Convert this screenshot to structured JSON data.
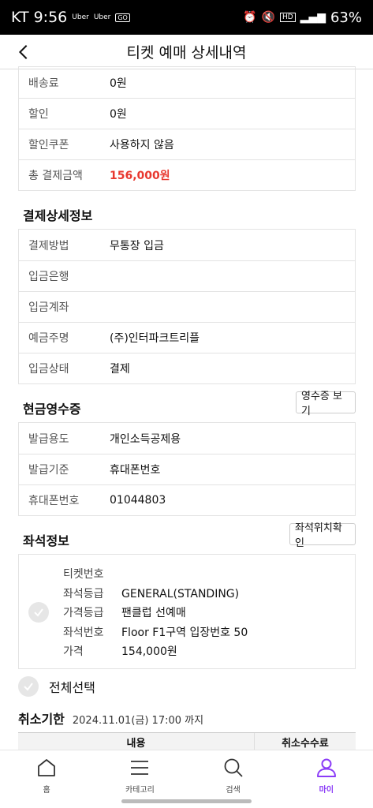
{
  "status_bar": {
    "carrier": "KT",
    "time": "9:56",
    "apps": [
      "Uber",
      "Uber"
    ],
    "badge": "GO",
    "network": "HD",
    "battery": "63%"
  },
  "header": {
    "title": "티켓 예매 상세내역"
  },
  "payment_summary": [
    {
      "key": "배송료",
      "value": "0원"
    },
    {
      "key": "할인",
      "value": "0원"
    },
    {
      "key": "할인쿠폰",
      "value": "사용하지 않음"
    },
    {
      "key": "총 결제금액",
      "value": "156,000원"
    }
  ],
  "payment_detail": {
    "title": "결제상세정보",
    "rows": [
      {
        "key": "결제방법",
        "value": "무통장 입금"
      },
      {
        "key": "입금은행",
        "value": ""
      },
      {
        "key": "입금계좌",
        "value": ""
      },
      {
        "key": "예금주명",
        "value": "(주)인터파크트리플"
      },
      {
        "key": "입금상태",
        "value": "결제"
      }
    ]
  },
  "cash_receipt": {
    "title": "현금영수증",
    "button": "영수증 보기",
    "rows": [
      {
        "key": "발급용도",
        "value": "개인소득공제용"
      },
      {
        "key": "발급기준",
        "value": "휴대폰번호"
      },
      {
        "key": "휴대폰번호",
        "value": "01044803"
      }
    ]
  },
  "seat_info": {
    "title": "좌석정보",
    "button": "좌석위치확인",
    "rows": [
      {
        "key": "티켓번호",
        "value": ""
      },
      {
        "key": "좌석등급",
        "value": "GENERAL(STANDING)"
      },
      {
        "key": "가격등급",
        "value": "팬클럽 선예매"
      },
      {
        "key": "좌석번호",
        "value": "Floor F1구역 입장번호 50"
      },
      {
        "key": "가격",
        "value": "154,000원"
      }
    ]
  },
  "select_all": "전체선택",
  "cancel_deadline": {
    "label": "취소기한",
    "date": "2024.11.01(금) 17:00 까지"
  },
  "fee_table": {
    "col1": "내용",
    "col2": "취소수수료"
  },
  "tabbar": [
    {
      "label": "홈",
      "icon": "home-icon",
      "active": false
    },
    {
      "label": "카테고리",
      "icon": "menu-icon",
      "active": false
    },
    {
      "label": "검색",
      "icon": "search-icon",
      "active": false
    },
    {
      "label": "마이",
      "icon": "person-icon",
      "active": true
    }
  ],
  "colors": {
    "accent": "#8b3cf7",
    "total_red": "#e8382f"
  }
}
